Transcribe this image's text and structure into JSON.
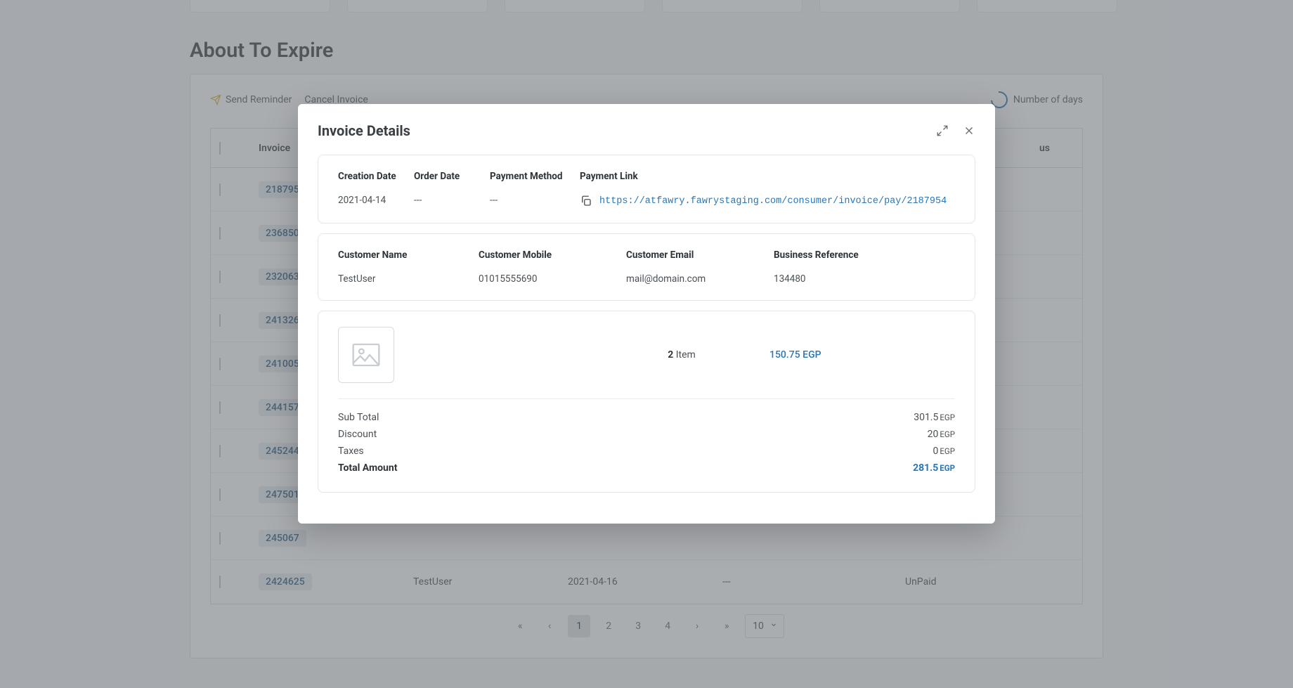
{
  "page": {
    "section_title": "About To Expire",
    "actions": {
      "send_reminder": "Send Reminder",
      "cancel_invoice": "Cancel Invoice",
      "number_of_days": "Number of days"
    },
    "table": {
      "headers": {
        "invoice": "Invoice",
        "status_trunc": "us"
      },
      "rows": [
        {
          "invoice": "218795",
          "name": "",
          "date": "",
          "dash": "",
          "status": ""
        },
        {
          "invoice": "236850",
          "name": "",
          "date": "",
          "dash": "",
          "status": ""
        },
        {
          "invoice": "232063",
          "name": "",
          "date": "",
          "dash": "",
          "status": ""
        },
        {
          "invoice": "241326",
          "name": "",
          "date": "",
          "dash": "",
          "status": ""
        },
        {
          "invoice": "241005",
          "name": "",
          "date": "",
          "dash": "",
          "status": ""
        },
        {
          "invoice": "244157",
          "name": "",
          "date": "",
          "dash": "",
          "status": ""
        },
        {
          "invoice": "245244",
          "name": "",
          "date": "",
          "dash": "",
          "status": ""
        },
        {
          "invoice": "247501",
          "name": "",
          "date": "",
          "dash": "",
          "status": ""
        },
        {
          "invoice": "245067",
          "name": "",
          "date": "",
          "dash": "",
          "status": ""
        },
        {
          "invoice": "2424625",
          "name": "TestUser",
          "date": "2021-04-16",
          "dash": "---",
          "status": "UnPaid"
        }
      ]
    },
    "pagination": {
      "pages": [
        "1",
        "2",
        "3",
        "4"
      ],
      "active": "1",
      "page_size": "10"
    }
  },
  "modal": {
    "title": "Invoice Details",
    "section1": {
      "headers": {
        "creation_date": "Creation Date",
        "order_date": "Order Date",
        "payment_method": "Payment Method",
        "payment_link": "Payment Link"
      },
      "values": {
        "creation_date": "2021-04-14",
        "order_date": "---",
        "payment_method": "---",
        "payment_link": "https://atfawry.fawrystaging.com/consumer/invoice/pay/2187954"
      }
    },
    "section2": {
      "headers": {
        "customer_name": "Customer Name",
        "customer_mobile": "Customer Mobile",
        "customer_email": "Customer Email",
        "business_reference": "Business Reference"
      },
      "values": {
        "customer_name": "TestUser",
        "customer_mobile": "01015555690",
        "customer_email": "mail@domain.com",
        "business_reference": "134480"
      }
    },
    "item": {
      "qty": "2",
      "qty_label": " Item",
      "price": "150.75 EGP"
    },
    "totals": {
      "sub_total_label": "Sub Total",
      "sub_total_value": "301.5",
      "sub_total_cur": "EGP",
      "discount_label": "Discount",
      "discount_value": "20",
      "discount_cur": "EGP",
      "taxes_label": "Taxes",
      "taxes_value": "0",
      "taxes_cur": "EGP",
      "total_label": "Total Amount",
      "total_value": "281.5",
      "total_cur": "EGP"
    }
  }
}
